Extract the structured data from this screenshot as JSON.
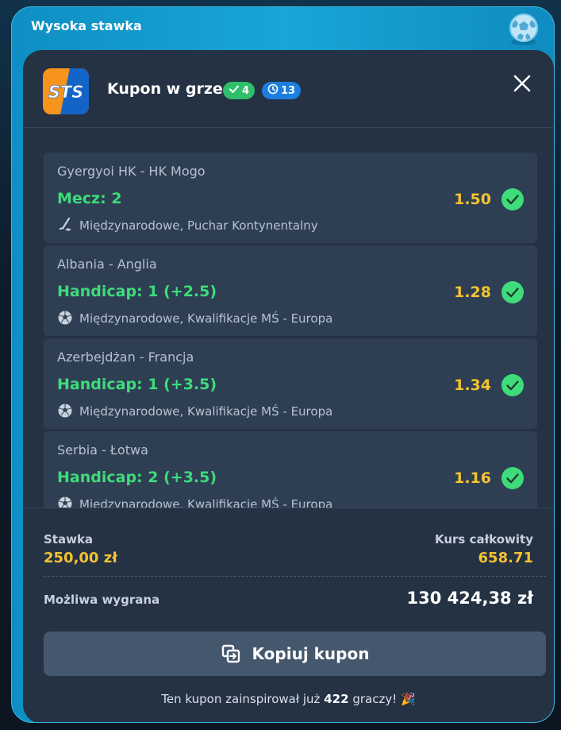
{
  "widget": {
    "title": "Wysoka stawka"
  },
  "coupon": {
    "title": "Kupon w grze",
    "won_count": "4",
    "live_count": "13",
    "brand_logo_text": "STS"
  },
  "bets": [
    {
      "teams": "Gyergyoi HK - HK Mogo",
      "pick": "Mecz: 2",
      "odds": "1.50",
      "league": "Międzynarodowe, Puchar Kontynentalny",
      "sport_icon": "hockey-icon",
      "status": "won"
    },
    {
      "teams": "Albania - Anglia",
      "pick": "Handicap: 1 (+2.5)",
      "odds": "1.28",
      "league": "Międzynarodowe, Kwalifikacje MŚ - Europa",
      "sport_icon": "football-icon",
      "status": "won"
    },
    {
      "teams": "Azerbejdżan - Francja",
      "pick": "Handicap: 1 (+3.5)",
      "odds": "1.34",
      "league": "Międzynarodowe, Kwalifikacje MŚ - Europa",
      "sport_icon": "football-icon",
      "status": "won"
    },
    {
      "teams": "Serbia - Łotwa",
      "pick": "Handicap: 2 (+3.5)",
      "odds": "1.16",
      "league": "Międzynarodowe, Kwalifikacje MŚ - Europa",
      "sport_icon": "football-icon",
      "status": "won"
    }
  ],
  "summary": {
    "stake_label": "Stawka",
    "stake_value": "250,00 zł",
    "total_odds_label": "Kurs całkowity",
    "total_odds_value": "658.71",
    "possible_win_label": "Możliwa wygrana",
    "possible_win_value": "130 424,38 zł"
  },
  "actions": {
    "copy_label": "Kopiuj kupon"
  },
  "footer": {
    "prefix": "Ten kupon zainspirował już",
    "count": "422",
    "suffix": "graczy!",
    "emoji": "🎉"
  },
  "colors": {
    "accent_blue": "#18a6d6",
    "card_bg": "#243244",
    "bet_bg": "#2e3f54",
    "pick_green": "#3edc7a",
    "odds_yellow": "#f4c232",
    "check_green": "#3edc7a",
    "live_badge": "#1c7fe0"
  }
}
